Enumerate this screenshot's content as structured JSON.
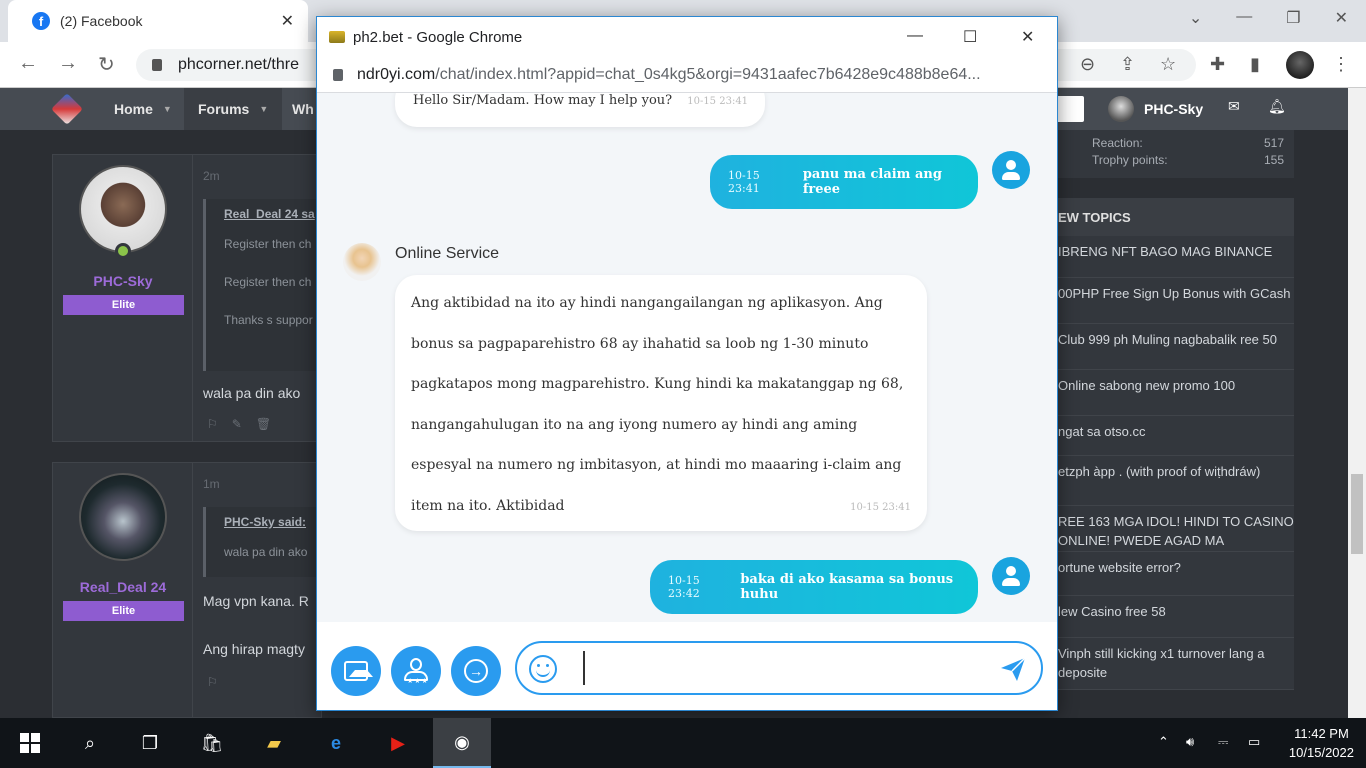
{
  "background_browser": {
    "tabs": [
      {
        "title": "(2) Facebook"
      }
    ],
    "address": "phcorner.net/thre"
  },
  "site": {
    "nav": [
      "Home",
      "Forums",
      "Wh"
    ],
    "user": "PHC-Sky",
    "stats": [
      {
        "label": "Reaction:",
        "value": "517"
      },
      {
        "label": "Trophy points:",
        "value": "155"
      }
    ],
    "new_topics_title": "EW TOPICS",
    "topics": [
      "IBRENG NFT BAGO MAG BINANCE",
      "00PHP Free Sign Up Bonus with GCash",
      "Club 999 ph Muling nagbabalik ree 50",
      "Online sabong new promo 100",
      "ngat sa otso.cc",
      "etzph àpp . (with proof of wiṭhdráw)",
      "REE 163 MGA IDOL! HINDI TO CASINO ONLINE! PWEDE AGAD MA",
      "ortune website error?",
      "lew Casino free 58",
      "Vinph still kicking x1 turnover lang a deposite"
    ]
  },
  "posts": [
    {
      "time": "2m",
      "username": "PHC-Sky",
      "rank": "Elite",
      "quote_author": "Real_Deal 24 sa",
      "quote_lines": [
        "Register then ch",
        "Register then ch",
        "Thanks s suppor"
      ],
      "text": "wala pa din ako"
    },
    {
      "time": "1m",
      "username": "Real_Deal 24",
      "rank": "Elite",
      "quote_author": "PHC-Sky said:",
      "quote_lines": [
        "wala pa din ako"
      ],
      "text": "Mag vpn kana. R",
      "text2": "Ang hirap magty"
    }
  ],
  "popup": {
    "window_title": "ph2.bet - Google Chrome",
    "url_host": "ndr0yi.com",
    "url_path": "/chat/index.html?appid=chat_0s4kg5&orgi=9431aafec7b6428e9c488b8e64...",
    "agent_name": "Online Service",
    "messages": [
      {
        "from": "agent",
        "text": "Hello Sir/Madam. How may I help you?",
        "time": "10-15 23:41"
      },
      {
        "from": "user",
        "text": "panu ma claim ang freee",
        "time": "10-15 23:41"
      },
      {
        "from": "agent",
        "text": "Ang aktibidad na ito ay hindi nangangailangan ng aplikasyon. Ang bonus sa pagpaparehistro 68 ay ihahatid sa loob ng 1-30 minuto pagkatapos mong magparehistro. Kung hindi ka makatanggap ng 68, nangangahulugan ito na ang iyong numero ay hindi ang aming espesyal na numero ng imbitasyon, at hindi mo maaaring i-claim ang item na ito. Aktibidad",
        "time": "10-15 23:41"
      },
      {
        "from": "user",
        "text": "baka di ako kasama sa bonus huhu",
        "time": "10-15 23:42"
      }
    ],
    "input_value": "",
    "colors": {
      "accent": "#2a9bef",
      "user_bubble": "#15bcdc"
    }
  },
  "taskbar": {
    "time": "11:42 PM",
    "date": "10/15/2022"
  }
}
